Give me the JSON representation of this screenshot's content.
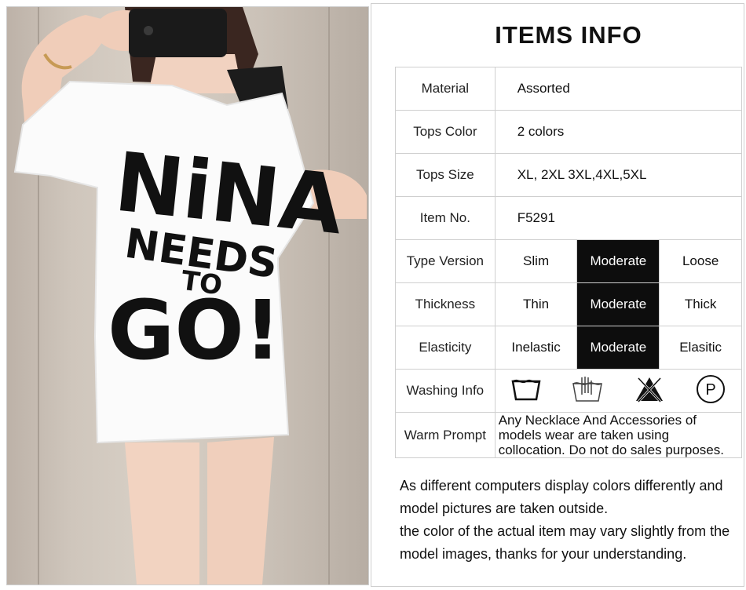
{
  "title": "ITEMS INFO",
  "rows": {
    "material": {
      "label": "Material",
      "value": "Assorted"
    },
    "color": {
      "label": "Tops Color",
      "value": "2 colors"
    },
    "size": {
      "label": "Tops Size",
      "value": "XL, 2XL 3XL,4XL,5XL"
    },
    "item": {
      "label": "Item No.",
      "value": "F5291"
    },
    "type_version": {
      "label": "Type Version",
      "options": [
        "Slim",
        "Moderate",
        "Loose"
      ],
      "selected": "Moderate"
    },
    "thickness": {
      "label": "Thickness",
      "options": [
        "Thin",
        "Moderate",
        "Thick"
      ],
      "selected": "Moderate"
    },
    "elasticity": {
      "label": "Elasticity",
      "options": [
        "Inelastic",
        "Moderate",
        "Elasitic"
      ],
      "selected": "Moderate"
    },
    "washing": {
      "label": "Washing Info",
      "icons": [
        "wash-tub-icon",
        "hand-wash-icon",
        "no-bleach-icon",
        "dry-clean-p-icon"
      ],
      "p_letter": "P"
    },
    "prompt": {
      "label": "Warm Prompt",
      "text": "Any Necklace And Accessories of models wear are taken using collocation. Do not do sales purposes."
    }
  },
  "disclaimer": {
    "line1": "As different computers display colors differently and model pictures are taken outside.",
    "line2": "the color of the actual item may vary slightly from the model images, thanks for your understanding."
  },
  "shirt_print": {
    "line1": "NiNA",
    "line2": "NEEDS",
    "line3": "TO",
    "line4": "GO!"
  },
  "colors": {
    "selected_bg": "#0d0d0d",
    "border": "#cfcfcf"
  }
}
